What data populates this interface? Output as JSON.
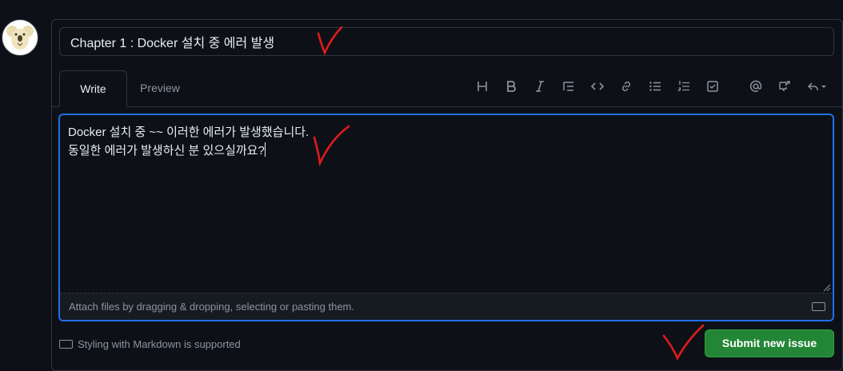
{
  "avatar": {
    "icon": "koala-avatar-icon"
  },
  "issue": {
    "title_value": "Chapter 1 : Docker 설치 중 에러 발생",
    "body_line1": "Docker 설치 중 ~~ 이러한 에러가 발생했습니다.",
    "body_line2": "동일한 에러가 발생하신 분 있으실까요?"
  },
  "tabs": {
    "write": "Write",
    "preview": "Preview"
  },
  "toolbar": {
    "icons": [
      "heading-icon",
      "bold-icon",
      "italic-icon",
      "quote-icon",
      "code-icon",
      "link-icon",
      "unordered-list-icon",
      "ordered-list-icon",
      "task-list-icon",
      "mention-icon",
      "reference-icon",
      "undo-icon"
    ]
  },
  "attach": {
    "hint": "Attach files by dragging & dropping, selecting or pasting them."
  },
  "footer": {
    "markdown_note": "Styling with Markdown is supported"
  },
  "actions": {
    "submit_label": "Submit new issue"
  },
  "colors": {
    "accent": "#1f6feb",
    "submit": "#238636",
    "annotation": "#e01b1b"
  }
}
